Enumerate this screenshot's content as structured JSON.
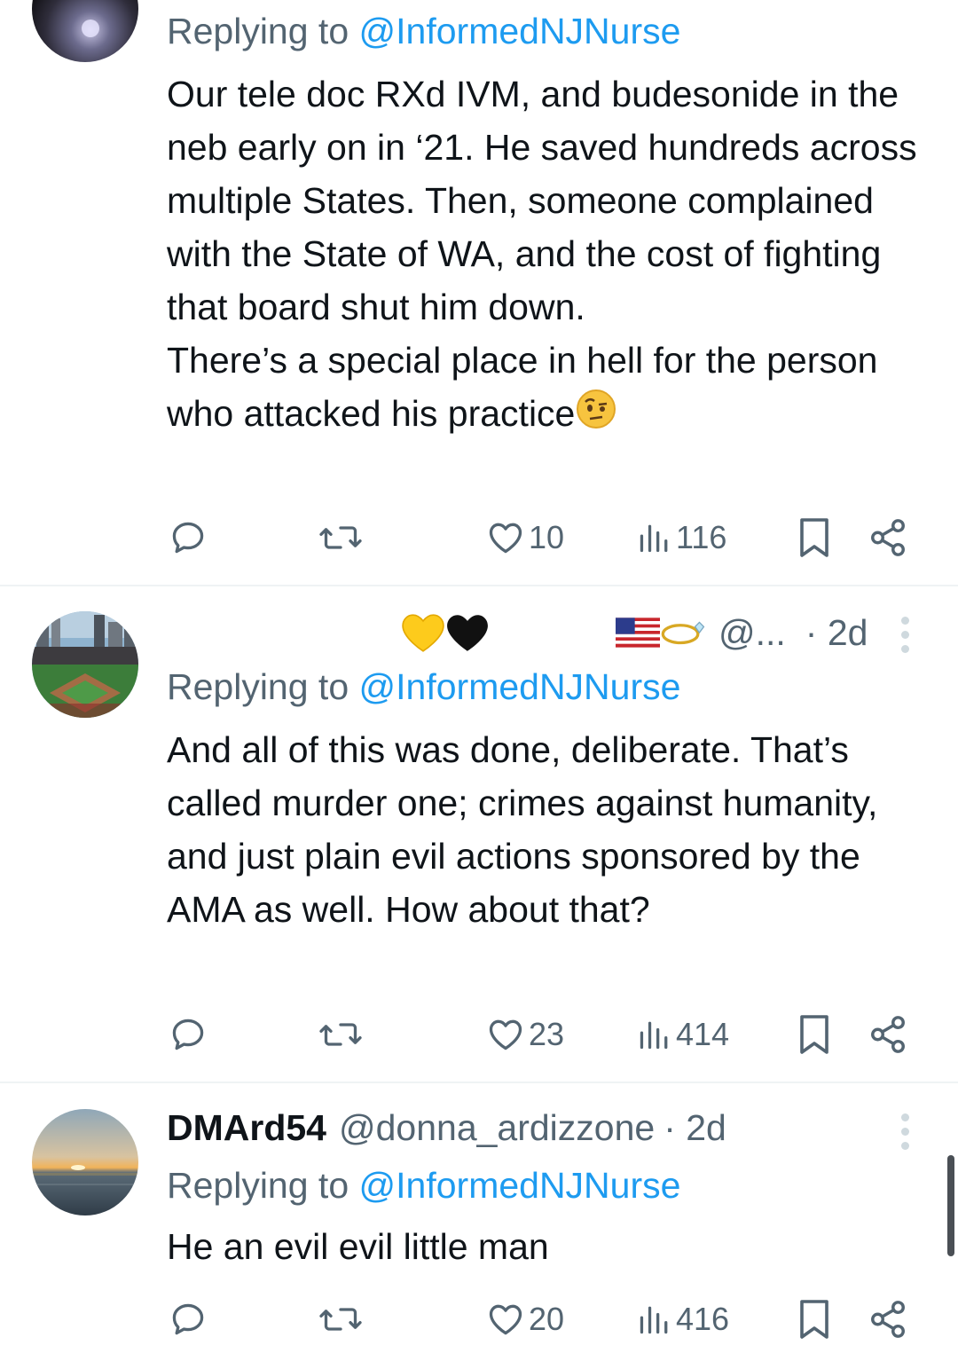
{
  "replying_prefix": "Replying to",
  "tweets": [
    {
      "reply_to": "@InformedNJNurse",
      "lines": [
        "Our tele doc RXd IVM, and budesonide in the neb early on in ‘21. He saved hundreds across multiple States. Then, someone complained with the State of WA, and the cost of fighting that board shut him down.",
        "There’s a special place in hell for the person who attacked his practice"
      ],
      "reply_count": "",
      "retweet_count": "",
      "like_count": "10",
      "view_count": "116"
    },
    {
      "display_name": "",
      "handle": "@...",
      "time": "· 2d",
      "reply_to": "@InformedNJNurse",
      "lines": [
        "And all of this was done, deliberate. That’s called murder one; crimes against humanity, and just plain evil actions sponsored by the AMA as well. How about that?"
      ],
      "reply_count": "",
      "retweet_count": "",
      "like_count": "23",
      "view_count": "414"
    },
    {
      "display_name": "DMArd54",
      "handle": "@donna_ardizzone",
      "time": "· 2d",
      "reply_to": "@InformedNJNurse",
      "lines": [
        "He an evil evil little man"
      ],
      "reply_count": "",
      "retweet_count": "",
      "like_count": "20",
      "view_count": "416"
    }
  ],
  "colors": {
    "text": "#0f1419",
    "secondary": "#536471",
    "link": "#1d9bf0",
    "divider": "#eff3f4"
  },
  "icons": [
    "reply-icon",
    "retweet-icon",
    "like-icon",
    "views-icon",
    "bookmark-icon",
    "share-icon",
    "more-icon",
    "yellow-heart-emoji",
    "black-heart-emoji",
    "us-flag-emoji",
    "ring-emoji",
    "raised-eyebrow-emoji"
  ]
}
